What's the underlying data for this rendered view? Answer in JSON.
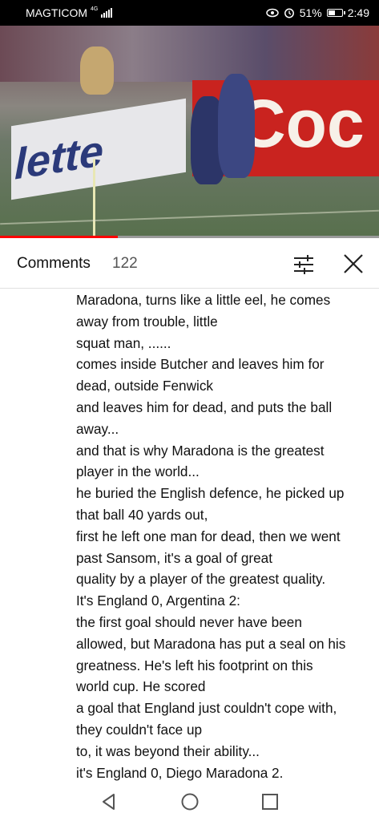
{
  "status_bar": {
    "carrier": "MAGTICOM",
    "network": "4G",
    "battery": "51%",
    "time": "2:49"
  },
  "video": {
    "sign_left": "lette",
    "sign_right": "Coc",
    "progress": 0.31
  },
  "comments": {
    "title": "Comments",
    "count": "122"
  },
  "comment_text": [
    "Maradona, turns like a little eel, he comes",
    "away from trouble, little",
    "squat man, ......",
    "comes inside Butcher and leaves him for",
    "dead, outside Fenwick",
    "and leaves him for dead, and puts the ball",
    "away...",
    "and that is why Maradona is the greatest",
    "player in the world...",
    "he buried the English defence, he picked up",
    "that ball 40 yards out,",
    "first he left one man for dead, then we went",
    "past Sansom, it's a goal of great",
    "quality by a player of the greatest quality.",
    "It's England 0, Argentina 2:",
    "the first goal should never have been",
    "allowed, but Maradona has put a seal on his",
    "greatness. He's left his footprint on this",
    "world cup. He scored",
    "a goal that England just couldn't cope with,",
    "they couldn't face up",
    "to, it was beyond their ability...",
    "it's England 0, Diego Maradona 2."
  ],
  "icons": {
    "filter": "tune-icon",
    "close": "close-icon",
    "back": "back-triangle-icon",
    "home": "home-circle-icon",
    "recents": "recents-square-icon"
  },
  "colors": {
    "progress": "#ff0000",
    "track": "#9a9a9a",
    "text": "#111111"
  }
}
